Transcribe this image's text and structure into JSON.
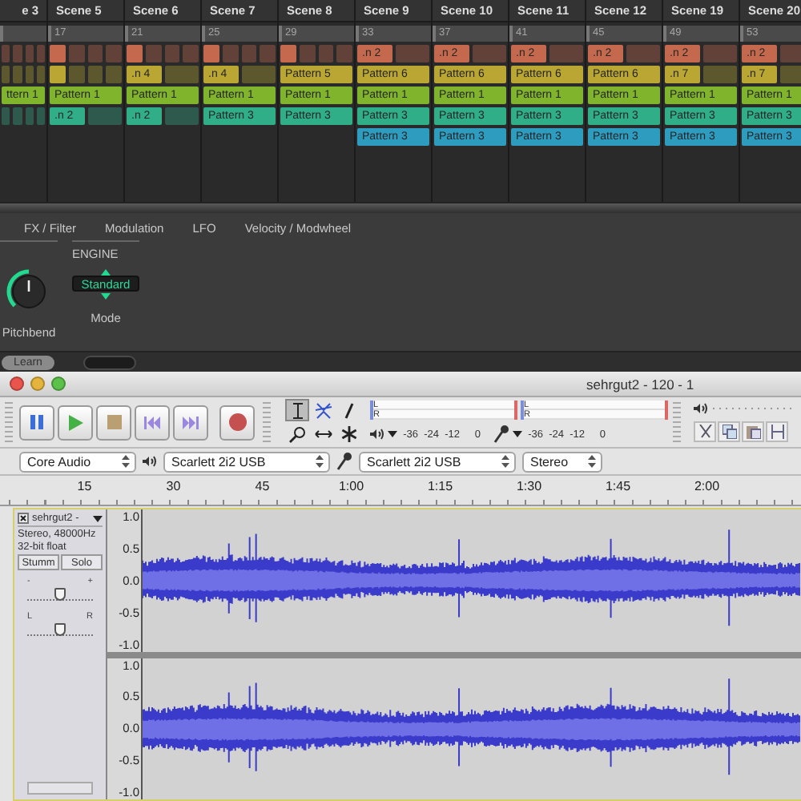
{
  "arranger": {
    "tracks": [
      {
        "color": "#c4694d"
      },
      {
        "color": "#b9a633"
      },
      {
        "color": "#80b42c"
      },
      {
        "color": "#2fae88"
      },
      {
        "color": "#2e9cbf"
      }
    ],
    "scenes": [
      {
        "name": "e 3",
        "kind": "cut",
        "slots": [
          {
            "kind": "empty"
          },
          {
            "kind": "empty"
          },
          {
            "kind": "full",
            "label": "ttern 1"
          },
          {
            "kind": "empty"
          },
          {
            "kind": "none"
          }
        ]
      },
      {
        "name": "Scene 5",
        "kind": "whole",
        "bar": "17",
        "slots": [
          {
            "kind": "quarter"
          },
          {
            "kind": "quarter"
          },
          {
            "kind": "full",
            "label": "Pattern 1"
          },
          {
            "kind": "half",
            "label": ".n 2"
          },
          {
            "kind": "none"
          }
        ]
      },
      {
        "name": "Scene 6",
        "kind": "whole",
        "bar": "21",
        "slots": [
          {
            "kind": "quarter"
          },
          {
            "kind": "half",
            "label": ".n 4"
          },
          {
            "kind": "full",
            "label": "Pattern 1"
          },
          {
            "kind": "half",
            "label": ".n 2"
          },
          {
            "kind": "none"
          }
        ]
      },
      {
        "name": "Scene 7",
        "kind": "whole",
        "bar": "25",
        "slots": [
          {
            "kind": "quarter"
          },
          {
            "kind": "half",
            "label": ".n 4"
          },
          {
            "kind": "full",
            "label": "Pattern 1"
          },
          {
            "kind": "full",
            "label": "Pattern 3"
          },
          {
            "kind": "none"
          }
        ]
      },
      {
        "name": "Scene 8",
        "kind": "whole",
        "bar": "29",
        "slots": [
          {
            "kind": "quarter"
          },
          {
            "kind": "full",
            "label": "Pattern 5"
          },
          {
            "kind": "full",
            "label": "Pattern 1"
          },
          {
            "kind": "full",
            "label": "Pattern 3"
          },
          {
            "kind": "none"
          }
        ]
      },
      {
        "name": "Scene 9",
        "kind": "whole",
        "bar": "33",
        "slots": [
          {
            "kind": "half",
            "label": ".n 2"
          },
          {
            "kind": "full",
            "label": "Pattern 6"
          },
          {
            "kind": "full",
            "label": "Pattern 1"
          },
          {
            "kind": "full",
            "label": "Pattern 3"
          },
          {
            "kind": "full",
            "label": "Pattern 3"
          }
        ]
      },
      {
        "name": "Scene 10",
        "kind": "whole",
        "bar": "37",
        "slots": [
          {
            "kind": "half",
            "label": ".n 2"
          },
          {
            "kind": "full",
            "label": "Pattern 6"
          },
          {
            "kind": "full",
            "label": "Pattern 1"
          },
          {
            "kind": "full",
            "label": "Pattern 3"
          },
          {
            "kind": "full",
            "label": "Pattern 3"
          }
        ]
      },
      {
        "name": "Scene 11",
        "kind": "whole",
        "bar": "41",
        "slots": [
          {
            "kind": "half",
            "label": ".n 2"
          },
          {
            "kind": "full",
            "label": "Pattern 6"
          },
          {
            "kind": "full",
            "label": "Pattern 1"
          },
          {
            "kind": "full",
            "label": "Pattern 3"
          },
          {
            "kind": "full",
            "label": "Pattern 3"
          }
        ]
      },
      {
        "name": "Scene 12",
        "kind": "whole",
        "bar": "45",
        "slots": [
          {
            "kind": "half",
            "label": ".n 2"
          },
          {
            "kind": "full",
            "label": "Pattern 6"
          },
          {
            "kind": "full",
            "label": "Pattern 1"
          },
          {
            "kind": "full",
            "label": "Pattern 3"
          },
          {
            "kind": "full",
            "label": "Pattern 3"
          }
        ]
      },
      {
        "name": "Scene 19",
        "kind": "whole",
        "bar": "49",
        "slots": [
          {
            "kind": "half",
            "label": ".n 2"
          },
          {
            "kind": "half",
            "label": ".n 7"
          },
          {
            "kind": "full",
            "label": "Pattern 1"
          },
          {
            "kind": "full",
            "label": "Pattern 3"
          },
          {
            "kind": "full",
            "label": "Pattern 3"
          }
        ]
      },
      {
        "name": "Scene 20",
        "kind": "whole",
        "bar": "53",
        "slots": [
          {
            "kind": "half",
            "label": ".n 2"
          },
          {
            "kind": "half",
            "label": ".n 7"
          },
          {
            "kind": "full",
            "label": "Pattern 1"
          },
          {
            "kind": "full",
            "label": "Pattern 3"
          },
          {
            "kind": "full",
            "label": "Pattern 3"
          }
        ]
      }
    ]
  },
  "plugin": {
    "tabs": [
      "FX / Filter",
      "Modulation",
      "LFO",
      "Velocity / Modwheel"
    ],
    "section": "ENGINE",
    "knob": {
      "label": "Pitchbend",
      "level": 0.5
    },
    "mode": {
      "value": "Standard",
      "label": "Mode"
    },
    "learn_button": "Learn"
  },
  "audacity": {
    "title": "sehrgut2 - 120 - 1",
    "tools": [
      {
        "kind": "select",
        "selected": true
      },
      {
        "kind": "envelope",
        "selected": false
      },
      {
        "kind": "draw",
        "selected": false
      },
      {
        "kind": "zoom",
        "selected": false
      },
      {
        "kind": "timeshift",
        "selected": false
      },
      {
        "kind": "multi",
        "selected": false
      }
    ],
    "meters": [
      {
        "kind": "playback",
        "channels": [
          "L",
          "R"
        ],
        "scale": [
          "-36",
          "-24",
          "-12",
          "0"
        ]
      },
      {
        "kind": "record",
        "channels": [
          "L",
          "R"
        ],
        "scale": [
          "-36",
          "-24",
          "-12",
          "0"
        ]
      }
    ],
    "devices": {
      "host": "Core Audio",
      "output": "Scarlett 2i2 USB",
      "input": "Scarlett 2i2 USB",
      "channels": "Stereo"
    },
    "ruler": [
      "15",
      "30",
      "45",
      "1:00",
      "1:15",
      "1:30",
      "1:45",
      "2:00"
    ],
    "track": {
      "name": "sehrgut2 -",
      "info": [
        "Stereo, 48000Hz",
        "32-bit float"
      ],
      "buttons": [
        "Stumm",
        "Solo"
      ],
      "gain": {
        "min": "-",
        "max": "+",
        "level": 0.5
      },
      "pan": {
        "min": "L",
        "max": "R",
        "level": 0.5
      },
      "channels": [
        {
          "scale": [
            "1.0",
            "0.5",
            "0.0",
            "-0.5",
            "-1.0"
          ]
        },
        {
          "scale": [
            "1.0",
            "0.5",
            "0.0",
            "-0.5",
            "-1.0"
          ]
        }
      ]
    }
  }
}
